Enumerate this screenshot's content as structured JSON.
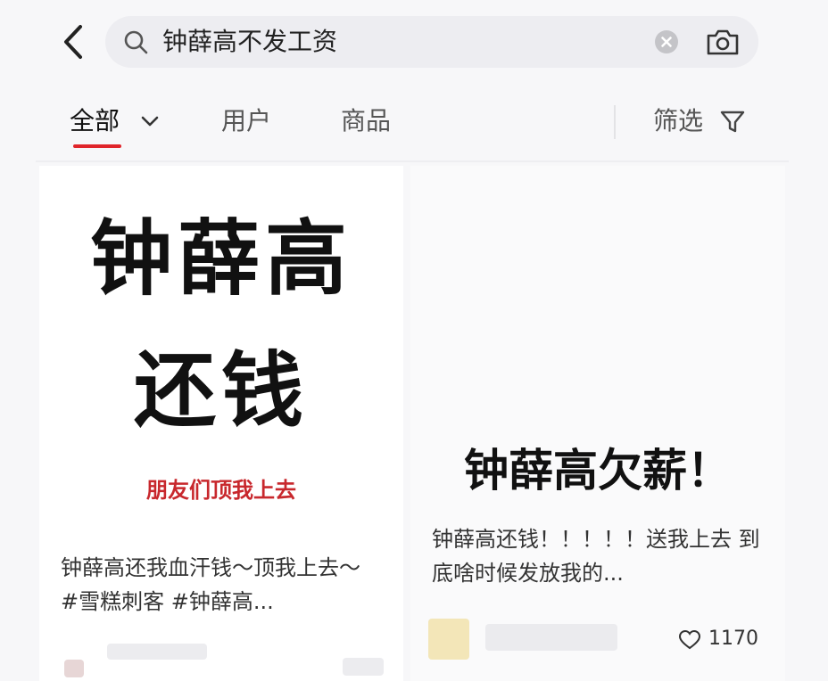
{
  "search": {
    "query": "钟薛高不发工资"
  },
  "tabs": {
    "all": "全部",
    "users": "用户",
    "goods": "商品",
    "filter": "筛选"
  },
  "results": [
    {
      "cover_lines": [
        "钟薛高",
        "还钱"
      ],
      "cover_subtitle": "朋友们顶我上去",
      "title": "钟薛高还我血汗钱～顶我上去～ #雪糕刺客 #钟薛高..."
    },
    {
      "cover_lines": [
        "钟薛高欠薪！"
      ],
      "title": "钟薛高还钱！！！！！送我上去 到底啥时候发放我的...",
      "likes": "1170"
    }
  ],
  "colors": {
    "accent": "#e0252b",
    "cover_red": "#c8282d"
  },
  "icons": [
    "back-arrow-icon",
    "search-icon",
    "clear-icon",
    "camera-icon",
    "chevron-down-icon",
    "filter-funnel-icon",
    "heart-icon"
  ]
}
